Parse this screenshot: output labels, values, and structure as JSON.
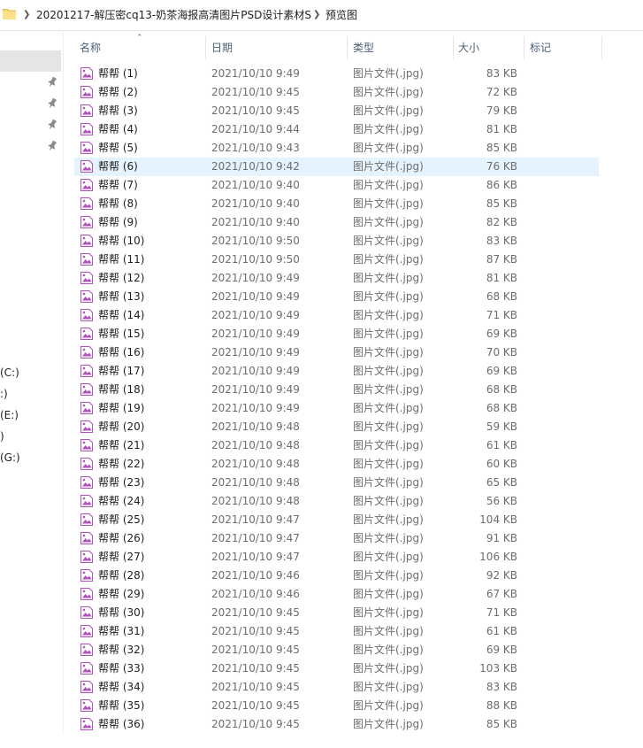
{
  "address_bar": {
    "path": [
      "20201217-解压密cq13-奶茶海报高清图片PSD设计素材S",
      "预览图"
    ]
  },
  "navigation": {
    "drives": [
      "(C:)",
      ":)",
      "(E:)",
      ")",
      "(G:)"
    ]
  },
  "columns": {
    "name": "名称",
    "date": "日期",
    "type": "类型",
    "size": "大小",
    "tags": "标记"
  },
  "files": [
    {
      "name": "帮帮 (1)",
      "date": "2021/10/10 9:49",
      "type": "图片文件(.jpg)",
      "size": "83 KB"
    },
    {
      "name": "帮帮 (2)",
      "date": "2021/10/10 9:45",
      "type": "图片文件(.jpg)",
      "size": "72 KB"
    },
    {
      "name": "帮帮 (3)",
      "date": "2021/10/10 9:45",
      "type": "图片文件(.jpg)",
      "size": "79 KB"
    },
    {
      "name": "帮帮 (4)",
      "date": "2021/10/10 9:44",
      "type": "图片文件(.jpg)",
      "size": "81 KB"
    },
    {
      "name": "帮帮 (5)",
      "date": "2021/10/10 9:43",
      "type": "图片文件(.jpg)",
      "size": "85 KB"
    },
    {
      "name": "帮帮 (6)",
      "date": "2021/10/10 9:42",
      "type": "图片文件(.jpg)",
      "size": "76 KB",
      "selected": true
    },
    {
      "name": "帮帮 (7)",
      "date": "2021/10/10 9:40",
      "type": "图片文件(.jpg)",
      "size": "86 KB"
    },
    {
      "name": "帮帮 (8)",
      "date": "2021/10/10 9:40",
      "type": "图片文件(.jpg)",
      "size": "85 KB"
    },
    {
      "name": "帮帮 (9)",
      "date": "2021/10/10 9:40",
      "type": "图片文件(.jpg)",
      "size": "82 KB"
    },
    {
      "name": "帮帮 (10)",
      "date": "2021/10/10 9:50",
      "type": "图片文件(.jpg)",
      "size": "83 KB"
    },
    {
      "name": "帮帮 (11)",
      "date": "2021/10/10 9:50",
      "type": "图片文件(.jpg)",
      "size": "87 KB"
    },
    {
      "name": "帮帮 (12)",
      "date": "2021/10/10 9:49",
      "type": "图片文件(.jpg)",
      "size": "81 KB"
    },
    {
      "name": "帮帮 (13)",
      "date": "2021/10/10 9:49",
      "type": "图片文件(.jpg)",
      "size": "68 KB"
    },
    {
      "name": "帮帮 (14)",
      "date": "2021/10/10 9:49",
      "type": "图片文件(.jpg)",
      "size": "71 KB"
    },
    {
      "name": "帮帮 (15)",
      "date": "2021/10/10 9:49",
      "type": "图片文件(.jpg)",
      "size": "69 KB"
    },
    {
      "name": "帮帮 (16)",
      "date": "2021/10/10 9:49",
      "type": "图片文件(.jpg)",
      "size": "70 KB"
    },
    {
      "name": "帮帮 (17)",
      "date": "2021/10/10 9:49",
      "type": "图片文件(.jpg)",
      "size": "69 KB"
    },
    {
      "name": "帮帮 (18)",
      "date": "2021/10/10 9:49",
      "type": "图片文件(.jpg)",
      "size": "68 KB"
    },
    {
      "name": "帮帮 (19)",
      "date": "2021/10/10 9:49",
      "type": "图片文件(.jpg)",
      "size": "68 KB"
    },
    {
      "name": "帮帮 (20)",
      "date": "2021/10/10 9:48",
      "type": "图片文件(.jpg)",
      "size": "59 KB"
    },
    {
      "name": "帮帮 (21)",
      "date": "2021/10/10 9:48",
      "type": "图片文件(.jpg)",
      "size": "61 KB"
    },
    {
      "name": "帮帮 (22)",
      "date": "2021/10/10 9:48",
      "type": "图片文件(.jpg)",
      "size": "60 KB"
    },
    {
      "name": "帮帮 (23)",
      "date": "2021/10/10 9:48",
      "type": "图片文件(.jpg)",
      "size": "65 KB"
    },
    {
      "name": "帮帮 (24)",
      "date": "2021/10/10 9:48",
      "type": "图片文件(.jpg)",
      "size": "56 KB"
    },
    {
      "name": "帮帮 (25)",
      "date": "2021/10/10 9:47",
      "type": "图片文件(.jpg)",
      "size": "104 KB"
    },
    {
      "name": "帮帮 (26)",
      "date": "2021/10/10 9:47",
      "type": "图片文件(.jpg)",
      "size": "91 KB"
    },
    {
      "name": "帮帮 (27)",
      "date": "2021/10/10 9:47",
      "type": "图片文件(.jpg)",
      "size": "106 KB"
    },
    {
      "name": "帮帮 (28)",
      "date": "2021/10/10 9:46",
      "type": "图片文件(.jpg)",
      "size": "92 KB"
    },
    {
      "name": "帮帮 (29)",
      "date": "2021/10/10 9:46",
      "type": "图片文件(.jpg)",
      "size": "67 KB"
    },
    {
      "name": "帮帮 (30)",
      "date": "2021/10/10 9:45",
      "type": "图片文件(.jpg)",
      "size": "71 KB"
    },
    {
      "name": "帮帮 (31)",
      "date": "2021/10/10 9:45",
      "type": "图片文件(.jpg)",
      "size": "61 KB"
    },
    {
      "name": "帮帮 (32)",
      "date": "2021/10/10 9:45",
      "type": "图片文件(.jpg)",
      "size": "69 KB"
    },
    {
      "name": "帮帮 (33)",
      "date": "2021/10/10 9:45",
      "type": "图片文件(.jpg)",
      "size": "103 KB"
    },
    {
      "name": "帮帮 (34)",
      "date": "2021/10/10 9:45",
      "type": "图片文件(.jpg)",
      "size": "83 KB"
    },
    {
      "name": "帮帮 (35)",
      "date": "2021/10/10 9:45",
      "type": "图片文件(.jpg)",
      "size": "88 KB"
    },
    {
      "name": "帮帮 (36)",
      "date": "2021/10/10 9:45",
      "type": "图片文件(.jpg)",
      "size": "85 KB"
    }
  ],
  "colors": {
    "selection": "#e5f3ff",
    "folder": "#f8d775",
    "image_icon": "#b44fbf",
    "header_text": "#4c607a"
  },
  "icons": {
    "folder": "folder-icon",
    "file": "image-file-icon",
    "pin": "pin-icon",
    "separator": "chevron-right-icon",
    "sort": "sort-ascending-icon"
  }
}
